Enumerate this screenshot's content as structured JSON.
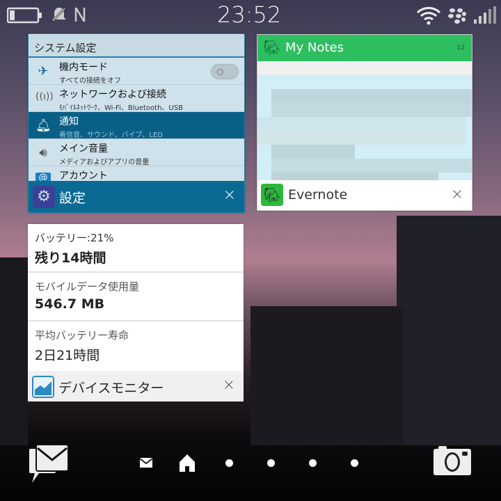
{
  "status_bar": {
    "time": "23:52",
    "icons": [
      "battery-icon",
      "notifications-muted-icon",
      "nfc-icon",
      "wifi-icon",
      "blackberry-icon",
      "signal-icon"
    ]
  },
  "settings_card": {
    "header": "システム設定",
    "rows": [
      {
        "title": "機内モード",
        "subtitle": "すべての接続をオフ",
        "icon": "airplane-icon",
        "toggle": false
      },
      {
        "title": "ネットワークおよび接続",
        "subtitle": "ﾓﾊﾞｲﾙﾈｯﾄﾜｰｸ、Wi-Fi、Bluetooth、USB",
        "icon": "antenna-icon"
      },
      {
        "title": "通知",
        "subtitle": "着信音、サウンド、バイブ、LED",
        "icon": "bell-icon",
        "selected": true
      },
      {
        "title": "メイン音量",
        "subtitle": "メディアおよびアプリの音量",
        "icon": "speaker-icon"
      },
      {
        "title": "アカウント",
        "subtitle": "",
        "icon": "at-icon"
      }
    ],
    "app_name": "設定",
    "close": "×",
    "accent": "#0b6a94"
  },
  "evernote_card": {
    "header": "My Notes",
    "count": "12",
    "app_name": "Evernote",
    "close": "×",
    "accent": "#2dbe60"
  },
  "monitor_card": {
    "sections": [
      {
        "label": "バッテリー:21%",
        "value": "残り14時間"
      },
      {
        "label": "モバイルデータ使用量",
        "value": "546.7 MB"
      },
      {
        "label": "平均バッテリー寿命",
        "value": "2日21時間"
      }
    ],
    "app_name": "デバイスモニター",
    "close": "×"
  },
  "dock": {
    "left": "hub-icon",
    "right": "camera-icon",
    "pages": [
      "hub-page",
      "home-page",
      "page-1",
      "page-2",
      "page-3",
      "page-4"
    ]
  }
}
